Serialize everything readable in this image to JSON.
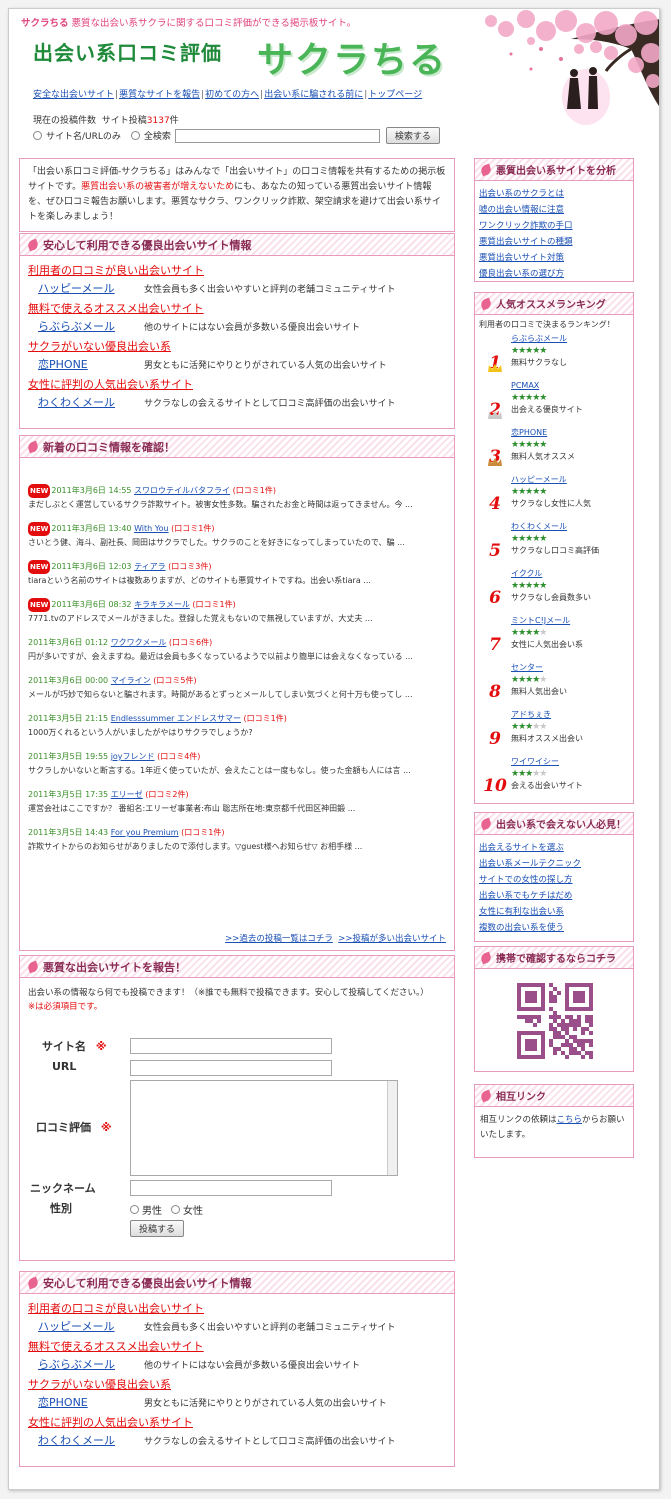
{
  "header": {
    "tagline_brand": "サクラちる",
    "tagline": "悪質な出会い系サクラに関する口コミ評価ができる掲示板サイト。",
    "subtitle": "出会い系口コミ評価",
    "logo": "サクラちる"
  },
  "nav": [
    "安全な出会いサイト",
    "悪質なサイトを報告",
    "初めての方へ",
    "出会い系に騙される前に",
    "トップページ"
  ],
  "stats": {
    "label": "現在の投稿件数",
    "site_label": "サイト投稿",
    "count": "3137",
    "unit": "件"
  },
  "search": {
    "opt1": "サイト名/URLのみ",
    "opt2": "全検索",
    "button": "検索する"
  },
  "intro": {
    "p1": "「出会い系口コミ評価-サクラちる」はみんなで「出会いサイト」の口コミ情報を共有するための掲示板サイトです。",
    "p2": "悪質出会い系の被害者が増えないため",
    "p3": "にも、あなたの知っている悪質出会いサイト情報を、ぜひ口コミ報告お願いします。悪質なサクラ、ワンクリック詐欺、架空請求を避けて出会い系サイトを楽しみましょう！"
  },
  "good_sites": {
    "heading": "安心して利用できる優良出会いサイト情報",
    "sections": [
      {
        "title": "利用者の口コミが良い出会いサイト",
        "site": "ハッピーメール",
        "desc": "女性会員も多く出会いやすいと評判の老舗コミュニティサイト"
      },
      {
        "title": "無料で使えるオススメ出会いサイト",
        "site": "らぶらぶメール",
        "desc": "他のサイトにはない会員が多数いる優良出会いサイト"
      },
      {
        "title": "サクラがいない優良出会い系",
        "site": "恋PHONE",
        "desc": "男女ともに活発にやりとりがされている人気の出会いサイト"
      },
      {
        "title": "女性に評判の人気出会い系サイト",
        "site": "わくわくメール",
        "desc": "サクラなしの会えるサイトとして口コミ高評価の出会いサイト"
      }
    ]
  },
  "latest": {
    "heading": "新着の口コミ情報を確認！",
    "new_badge": "NEW",
    "posts": [
      {
        "new": true,
        "date": "2011年3月6日 14:55",
        "site": "スワロウテイルバタフライ",
        "count": "(口コミ1件)",
        "excerpt": "まだしぶとく運営しているサクラ詐欺サイト。被害女性多数。騙されたお金と時間は返ってきません。今 ..."
      },
      {
        "new": true,
        "date": "2011年3月6日 13:40",
        "site": "With You",
        "count": "(口コミ1件)",
        "excerpt": "さいとう健、海斗、副社長、岡田はサクラでした。サクラのことを好きになってしまっていたので、騙 ..."
      },
      {
        "new": true,
        "date": "2011年3月6日 12:03",
        "site": "ティアラ",
        "count": "(口コミ3件)",
        "excerpt": "tiaraという名前のサイトは複数ありますが、どのサイトも悪質サイトですね。出会い系tiara ..."
      },
      {
        "new": true,
        "date": "2011年3月6日 08:32",
        "site": "キラキラメール",
        "count": "(口コミ1件)",
        "excerpt": "7771.tvのアドレスでメールがきました。登録した覚えもないので無視していますが、大丈夫 ..."
      },
      {
        "new": false,
        "date": "2011年3月6日 01:12",
        "site": "ワクワクメール",
        "count": "(口コミ6件)",
        "excerpt": "円が多いですが、会えますね。最近は会員も多くなっているようで以前より簡単には会えなくなっている ..."
      },
      {
        "new": false,
        "date": "2011年3月6日 00:00",
        "site": "マイライン",
        "count": "(口コミ5件)",
        "excerpt": "メールが巧妙で知らないと騙されます。時間があるとずっとメールしてしまい気づくと何十万も使ってし ..."
      },
      {
        "new": false,
        "date": "2011年3月5日 21:15",
        "site": "Endlesssummer エンドレスサマー",
        "count": "(口コミ1件)",
        "excerpt": "1000万くれるという人がいましたがやはりサクラでしょうか?"
      },
      {
        "new": false,
        "date": "2011年3月5日 19:55",
        "site": "joyフレンド",
        "count": "(口コミ4件)",
        "excerpt": "サクラしかいないと断言する。1年近く使っていたが、会えたことは一度もなし。使った金額も人には言 ..."
      },
      {
        "new": false,
        "date": "2011年3月5日 17:35",
        "site": "エリーゼ",
        "count": "(口コミ2件)",
        "excerpt": "運営会社はここですか？ 番組名:エリーゼ事業者:布山 聡志所在地:東京都千代田区神田鍛 ..."
      },
      {
        "new": false,
        "date": "2011年3月5日 14:43",
        "site": "For you Premium",
        "count": "(口コミ1件)",
        "excerpt": "詐欺サイトからのお知らせがありましたので添付します。▽guest様へお知らせ▽ お相手様 ..."
      }
    ],
    "link_past": ">>過去の投稿一覧はコチラ",
    "link_many": ">>投稿が多い出会いサイト"
  },
  "report": {
    "heading": "悪質な出会いサイトを報告！",
    "note": "出会い系の情報なら何でも投稿できます！（※誰でも無料で投稿できます。安心して投稿してください。）",
    "required": "※は必須項目です。",
    "mark": "※",
    "site_label": "サイト名",
    "url_label": "URL",
    "review_label": "口コミ評価",
    "nick_label": "ニックネーム",
    "gender_label": "性別",
    "male": "男性",
    "female": "女性",
    "submit": "投稿する"
  },
  "sidebar": {
    "analysis": {
      "heading": "悪質出会い系サイトを分析",
      "links": [
        "出会い系のサクラとは",
        "嘘の出会い情報に注意",
        "ワンクリック詐欺の手口",
        "悪質出会いサイトの種類",
        "悪質出会いサイト対策",
        "優良出会い系の選び方"
      ]
    },
    "ranking": {
      "heading": "人気オススメランキング",
      "intro": "利用者の口コミで決まるランキング！",
      "items": [
        {
          "rank": "1",
          "site": "らぶらぶメール",
          "stars": 5,
          "note": "無料サクラなし"
        },
        {
          "rank": "2",
          "site": "PCMAX",
          "stars": 5,
          "note": "出会える優良サイト"
        },
        {
          "rank": "3",
          "site": "恋PHONE",
          "stars": 5,
          "note": "無料人気オススメ"
        },
        {
          "rank": "4",
          "site": "ハッピーメール",
          "stars": 5,
          "note": "サクラなし女性に人気"
        },
        {
          "rank": "5",
          "site": "わくわくメール",
          "stars": 5,
          "note": "サクラなし口コミ高評価"
        },
        {
          "rank": "6",
          "site": "イククル",
          "stars": 5,
          "note": "サクラなし会員数多い"
        },
        {
          "rank": "7",
          "site": "ミントC!Jメール",
          "stars": 4,
          "note": "女性に人気出会い系"
        },
        {
          "rank": "8",
          "site": "センター",
          "stars": 4,
          "note": "無料人気出会い"
        },
        {
          "rank": "9",
          "site": "アドちぇき",
          "stars": 3,
          "note": "無料オススメ出会い"
        },
        {
          "rank": "10",
          "site": "ワイワイシー",
          "stars": 3,
          "note": "会える出会いサイト"
        }
      ]
    },
    "cantmeet": {
      "heading": "出会い系で会えない人必見！",
      "links": [
        "出会えるサイトを選ぶ",
        "出会い系メールテクニック",
        "サイトでの女性の探し方",
        "出会い系でもケチはだめ",
        "女性に有利な出会い系",
        "複数の出会い系を使う"
      ]
    },
    "mobile": {
      "heading": "携帯で確認するならコチラ"
    },
    "mutual": {
      "heading": "相互リンク",
      "text1": "相互リンクの依頼は",
      "link": "こちら",
      "text2": "からお願いいたします。"
    }
  },
  "colors": {
    "accent": "#e79abc",
    "link": "#1a4fb4",
    "red": "#e40d0d",
    "green": "#49b556"
  }
}
